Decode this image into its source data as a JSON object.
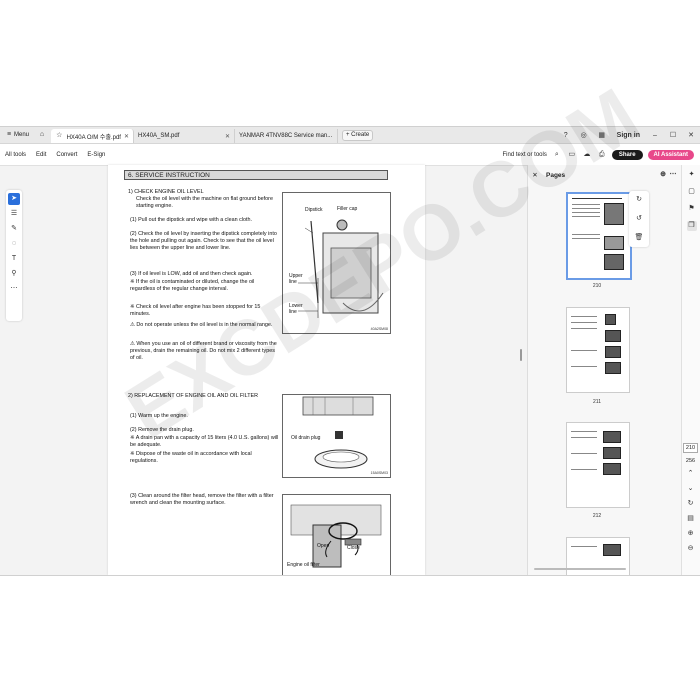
{
  "tabbar": {
    "menu_label": "Menu",
    "tabs": [
      {
        "label": "HX40A O/M 수출.pdf",
        "active": true
      },
      {
        "label": "HX40A_SM.pdf",
        "active": false
      },
      {
        "label": "YANMAR 4TNV88C Service man...",
        "active": false
      }
    ],
    "create_label": "+ Create",
    "signin_label": "Sign in"
  },
  "menubar": {
    "items": [
      "All tools",
      "Edit",
      "Convert",
      "E-Sign"
    ],
    "find_label": "Find text or tools",
    "share_label": "Share",
    "ai_label": "AI Assistant"
  },
  "doc": {
    "section_title": "6. SERVICE INSTRUCTION",
    "p1": "1) CHECK ENGINE OIL LEVEL",
    "p1_body": "Check the oil level with the machine on flat ground before starting engine.",
    "s1": "(1) Pull out the dipstick and wipe with a clean cloth.",
    "s2": "(2) Check the oil level by inserting the dipstick completely into the hole and pulling out again. Check to see that the oil level lies between the upper line and lower line.",
    "s3": "(3) If oil level is LOW, add oil and then check again.",
    "n1": "※ If the oil is contaminated or diluted, change the oil regardless of the regular change interval.",
    "n2": "※ Check oil level after engine has been stopped for 15 minutes.",
    "w1": "⚠ Do not operate unless the oil level is in the normal range.",
    "w2": "⚠ When you use an oil of different brand or viscosity from the previous, drain the remaining oil. Do not mix 2 different types of oil.",
    "p2": "2) REPLACEMENT OF ENGINE OIL AND OIL FILTER",
    "r1": "(1) Warm up the engine.",
    "r2": "(2) Remove the drain plug.",
    "r3": "※ A drain pan with a capacity of 15 liters (4.0 U.S. gallons) will be adequate.",
    "r4": "※ Dispose of the waste oil in accordance with local regulations.",
    "r5": "(3) Clean around the filter head, remove the filter with a filter wrench and clean the mounting surface.",
    "fig1": {
      "dipstick": "Dipstick",
      "filler": "Filler cap",
      "upper": "Upper line",
      "lower": "Lower line",
      "code": "40A2SM08"
    },
    "fig2": {
      "plug": "Oil drain plug",
      "code": "15A0SM03"
    },
    "fig3": {
      "open": "Open",
      "close": "Close",
      "filter": "Engine oil filter"
    }
  },
  "pages_panel": {
    "title": "Pages",
    "thumb_numbers": [
      "210",
      "211",
      "212"
    ]
  },
  "page_nav": {
    "current": "210",
    "total": "256"
  },
  "watermark": "EXCDEPO.COM"
}
